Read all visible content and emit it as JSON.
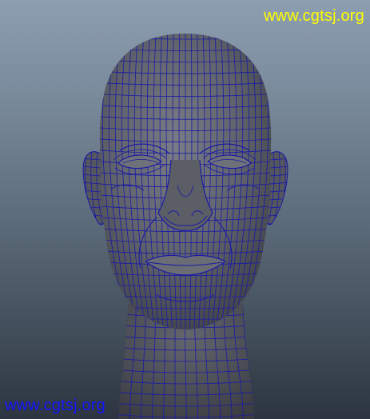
{
  "viewport": {
    "background_top": "#8d9eb0",
    "background_bottom": "#2c3540",
    "wireframe_color": "#1a1aa6",
    "shaded_color": "#5d5f66"
  },
  "watermarks": {
    "top_right": "www.cgtsj.org",
    "bottom_left": "www.cgtsj.org",
    "top_right_color": "#ffff00",
    "bottom_left_color": "#1414ff"
  },
  "model": {
    "subject": "head-mesh",
    "icon": "wireframe-head"
  }
}
